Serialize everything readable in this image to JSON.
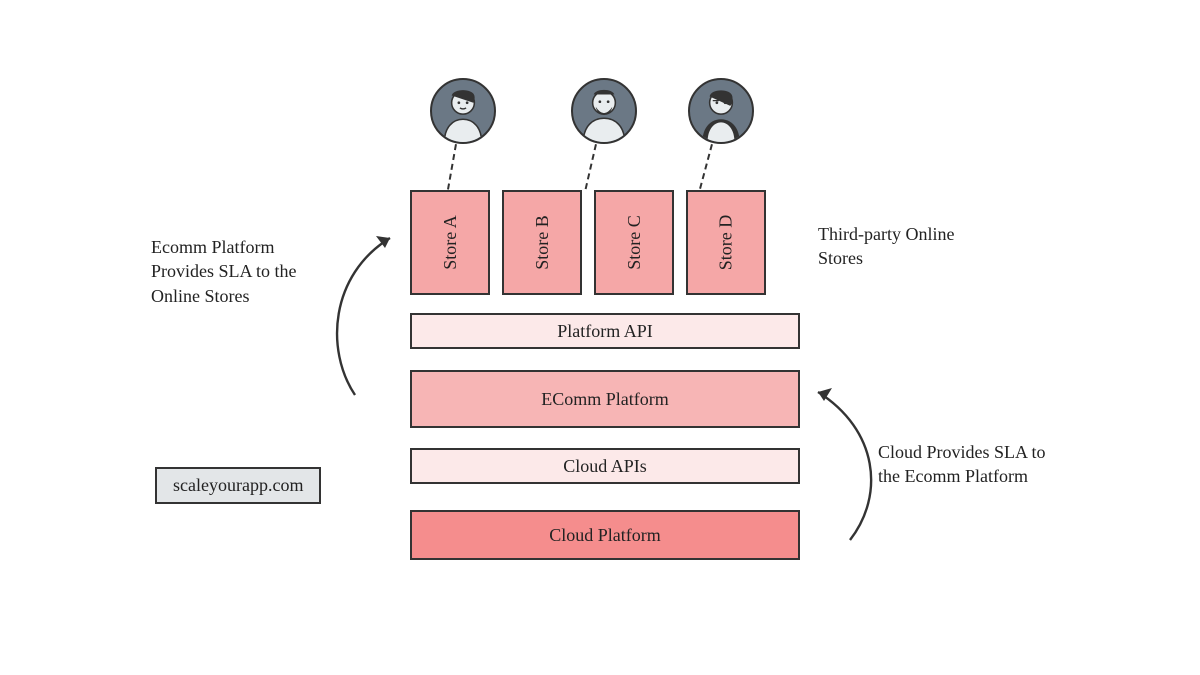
{
  "stores": {
    "a": "Store A",
    "b": "Store B",
    "c": "Store C",
    "d": "Store D"
  },
  "layers": {
    "platform_api": "Platform API",
    "ecomm_platform": "EComm Platform",
    "cloud_apis": "Cloud APIs",
    "cloud_platform": "Cloud Platform"
  },
  "annotations": {
    "left": "Ecomm Platform Provides SLA to the Online Stores",
    "right_top": "Third-party Online Stores",
    "right_bottom": "Cloud Provides SLA to the Ecomm Platform",
    "brand": "scaleyourapp.com"
  }
}
